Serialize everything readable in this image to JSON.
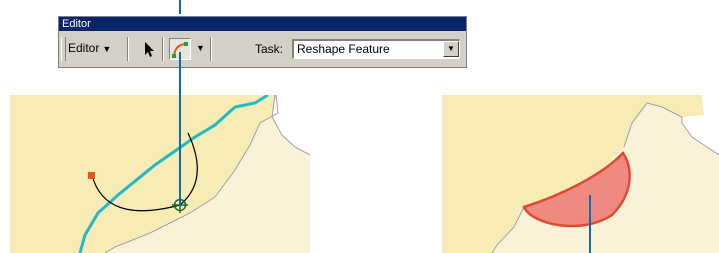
{
  "toolbar": {
    "title": "Editor",
    "editor_menu_label": "Editor",
    "task_label": "Task:",
    "task_value": "Reshape Feature"
  },
  "icons": {
    "arrow": "pointer-arrow-icon",
    "sketch": "sketch-curve-icon",
    "dropdown": "chevron-down-icon"
  },
  "colors": {
    "polygon_outer": "#f7ecb5",
    "polygon_inner": "#faf2d8",
    "sketch_line": "#24b8c4",
    "reshaped_fill": "#f08a80",
    "reshaped_outline": "#e04a30",
    "callout_line": "#0a6ea8",
    "title_bar": "#0a246a"
  }
}
